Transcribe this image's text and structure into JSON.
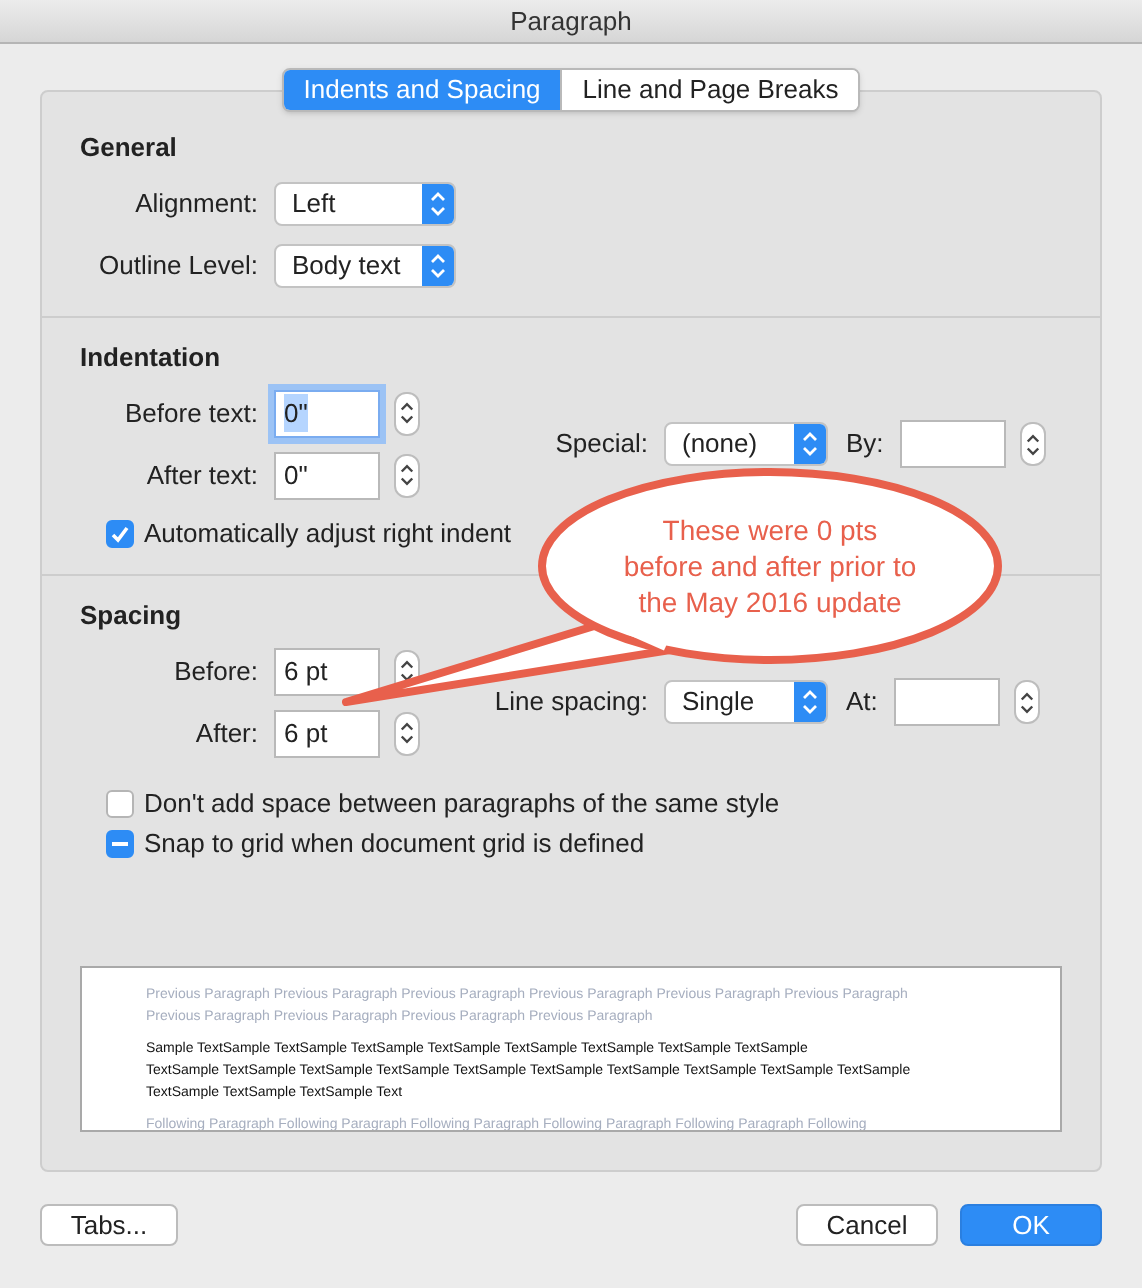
{
  "window": {
    "title": "Paragraph"
  },
  "tabs": [
    {
      "label": "Indents and Spacing",
      "selected": true
    },
    {
      "label": "Line and Page Breaks",
      "selected": false
    }
  ],
  "general": {
    "heading": "General",
    "fields": [
      {
        "label": "Alignment:",
        "value": "Left"
      },
      {
        "label": "Outline Level:",
        "value": "Body text"
      }
    ]
  },
  "indentation": {
    "heading": "Indentation",
    "fields": [
      {
        "label": "Before text:",
        "value": "0\"",
        "focused": true
      },
      {
        "label": "After text:",
        "value": "0\"",
        "focused": false
      }
    ],
    "special": {
      "label": "Special:",
      "value": "(none)"
    },
    "by": {
      "label": "By:"
    },
    "checkbox": {
      "label": "Automatically adjust right indent",
      "checked": true
    }
  },
  "spacing": {
    "heading": "Spacing",
    "fields": [
      {
        "label": "Before:",
        "value": "6 pt",
        "focused": false
      },
      {
        "label": "After:",
        "value": "6 pt",
        "focused": false
      }
    ],
    "line_spacing": {
      "label": "Line spacing:",
      "value": "Single"
    },
    "at": {
      "label": "At:"
    },
    "checkboxes": [
      {
        "label": "Don't add space between paragraphs of the same style",
        "checked": false
      },
      {
        "label": "Snap to grid when document grid is defined",
        "checked": true,
        "mixed": true
      }
    ]
  },
  "preview": {
    "previous": [
      "Previous Paragraph Previous Paragraph Previous Paragraph Previous Paragraph Previous Paragraph Previous Paragraph",
      "Previous Paragraph Previous Paragraph Previous Paragraph Previous Paragraph"
    ],
    "sample": [
      "Sample TextSample TextSample TextSample TextSample TextSample TextSample TextSample TextSample",
      "TextSample TextSample TextSample TextSample TextSample TextSample TextSample TextSample TextSample TextSample",
      "TextSample TextSample TextSample Text"
    ],
    "following": [
      "Following Paragraph Following Paragraph Following Paragraph Following Paragraph Following Paragraph Following"
    ]
  },
  "callout": {
    "text": "These were 0 pts before and after prior to the May 2016 update"
  },
  "buttons": [
    {
      "label": "Tabs...",
      "kind": "plain"
    },
    {
      "label": "Cancel",
      "kind": "plain"
    },
    {
      "label": "OK",
      "kind": "default"
    }
  ]
}
